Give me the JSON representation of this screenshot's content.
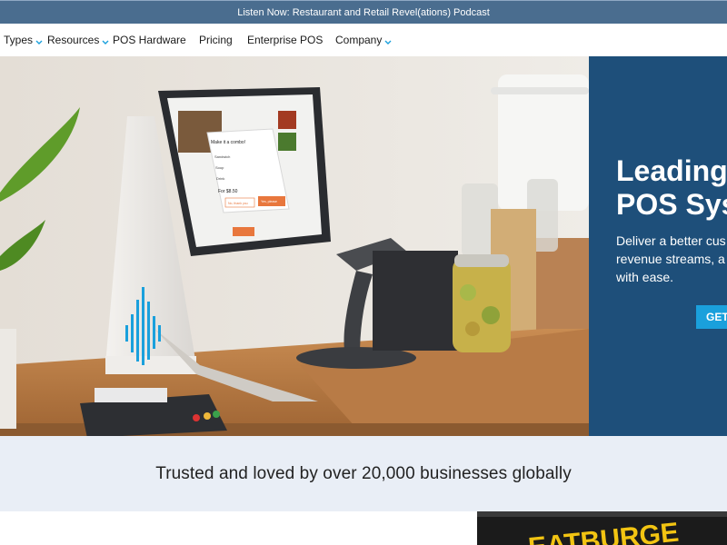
{
  "announcement": {
    "text": "Listen Now: Restaurant and Retail Revel(ations) Podcast"
  },
  "nav": {
    "items": [
      {
        "label": "Types",
        "has_dropdown": true
      },
      {
        "label": "Resources",
        "has_dropdown": true
      },
      {
        "label": "POS Hardware",
        "has_dropdown": false
      },
      {
        "label": "Pricing",
        "has_dropdown": false
      },
      {
        "label": "Enterprise POS",
        "has_dropdown": false
      },
      {
        "label": "Company",
        "has_dropdown": true
      }
    ],
    "chevron_color": "#1aa0dc"
  },
  "hero": {
    "title_line1": "Leading C",
    "title_line2": "POS Sys",
    "subtitle_line1": "Deliver a better cus",
    "subtitle_line2": "revenue streams, a",
    "subtitle_line3": "with ease.",
    "cta_label": "GET",
    "panel_color": "#1e4f7a",
    "cta_color": "#1aa0dc",
    "tablet_popup": {
      "title": "Make it a combo!",
      "options": [
        "Sandwich",
        "Soup",
        "Drink"
      ],
      "price": "For $8.50",
      "decline": "No, thank you",
      "accept": "Yes, please"
    }
  },
  "trust": {
    "text": "Trusted and loved by over 20,000 businesses globally"
  },
  "promo": {
    "partial_sign": "EATBURGE"
  }
}
